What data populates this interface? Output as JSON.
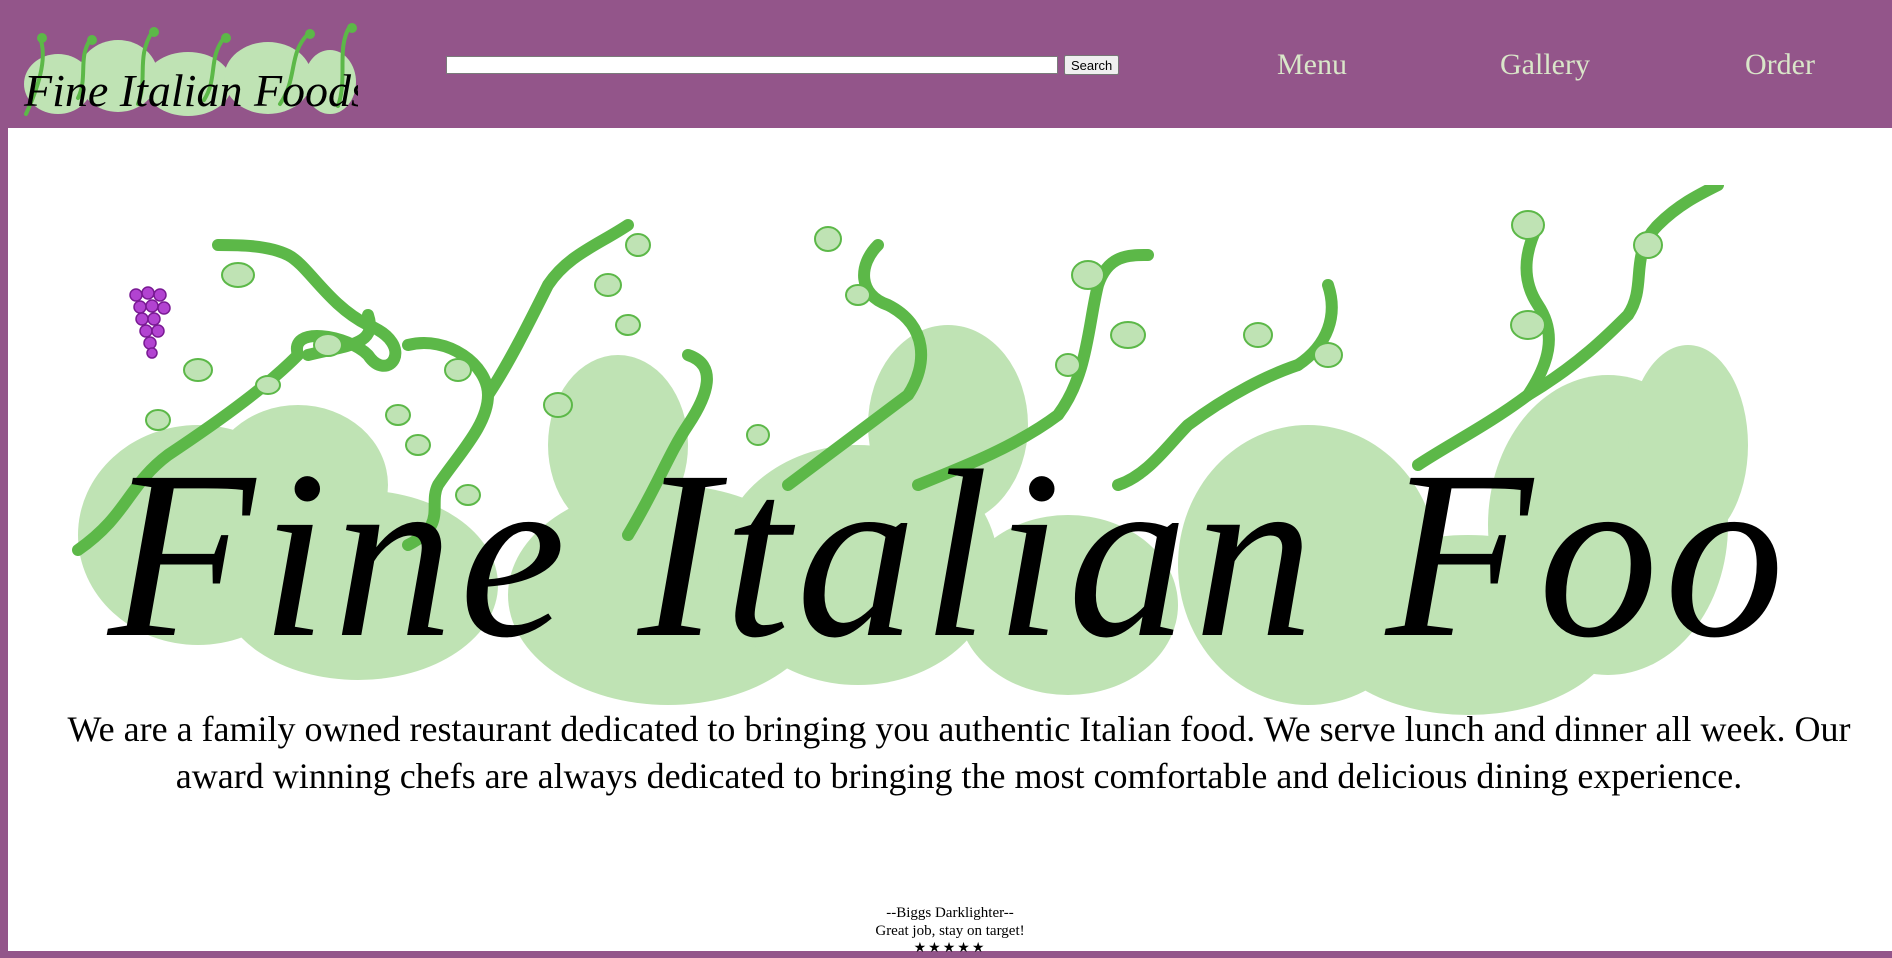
{
  "header": {
    "logo_text": "Fine Italian Foods",
    "search": {
      "placeholder": "",
      "value": "",
      "button_label": "Search"
    },
    "nav": [
      {
        "label": "Menu"
      },
      {
        "label": "Gallery"
      },
      {
        "label": "Order"
      }
    ]
  },
  "main": {
    "banner_text": "Fine Italian Foods",
    "intro": "We are a family owned restaurant dedicated to bringing you authentic Italian food. We serve lunch and dinner all week. Our award winning chefs are always dedicated to bringing the most comfortable and delicious dining experience.",
    "testimonial": {
      "author": "--Biggs Darklighter--",
      "quote": "Great job, stay on target!",
      "rating": "★★★★★"
    }
  },
  "colors": {
    "header_bg": "#93558a",
    "nav_text": "#d9e6c9",
    "vine_green": "#5cb848",
    "leaf_green": "#bfe3b4",
    "grape_purple": "#9b2fbf"
  }
}
